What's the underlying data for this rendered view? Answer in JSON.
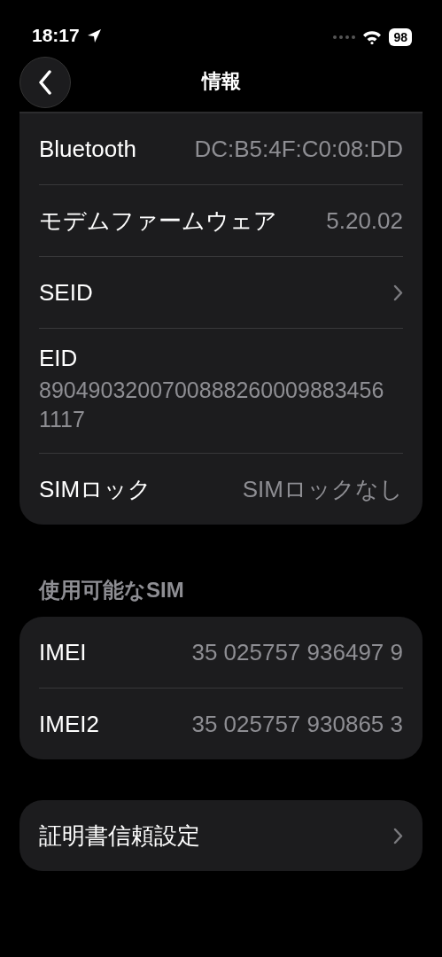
{
  "status_bar": {
    "time": "18:17",
    "battery": "98"
  },
  "nav": {
    "title": "情報"
  },
  "groups": [
    {
      "rows": [
        {
          "kind": "value",
          "label": "Bluetooth",
          "value": "DC:B5:4F:C0:08:DD"
        },
        {
          "kind": "value",
          "label": "モデムファームウェア",
          "value": "5.20.02"
        },
        {
          "kind": "link",
          "label": "SEID"
        },
        {
          "kind": "stacked",
          "label": "EID",
          "value": "89049032007008882600098834561117"
        },
        {
          "kind": "value",
          "label": "SIMロック",
          "value": "SIMロックなし"
        }
      ]
    },
    {
      "header": "使用可能なSIM",
      "rows": [
        {
          "kind": "value",
          "label": "IMEI",
          "value": "35 025757 936497 9"
        },
        {
          "kind": "value",
          "label": "IMEI2",
          "value": "35 025757 930865 3"
        }
      ]
    },
    {
      "rows": [
        {
          "kind": "link",
          "label": "証明書信頼設定"
        }
      ]
    }
  ]
}
